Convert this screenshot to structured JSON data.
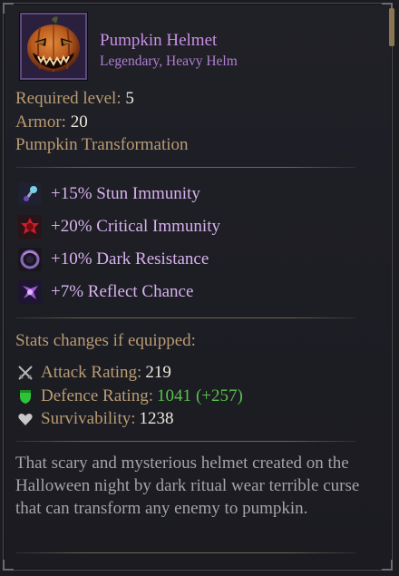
{
  "item": {
    "name": "Pumpkin Helmet",
    "subtitle": "Legendary, Heavy Helm",
    "icon": "pumpkin-helmet-icon"
  },
  "requirements": {
    "level_label": "Required level:",
    "level_value": "5",
    "armor_label": "Armor:",
    "armor_value": "20",
    "special": "Pumpkin Transformation"
  },
  "bonuses": [
    {
      "icon": "stun-immunity-icon",
      "text": "+15% Stun Immunity"
    },
    {
      "icon": "critical-immunity-icon",
      "text": "+20% Critical Immunity"
    },
    {
      "icon": "dark-resistance-icon",
      "text": "+10% Dark Resistance"
    },
    {
      "icon": "reflect-chance-icon",
      "text": "+7% Reflect Chance"
    }
  ],
  "stats": {
    "header": "Stats changes if equipped:",
    "attack_label": "Attack Rating:",
    "attack_value": "219",
    "defence_label": "Defence Rating:",
    "defence_value": "1041",
    "defence_delta": "(+257)",
    "survivability_label": "Survivability:",
    "survivability_value": "1238"
  },
  "description": "That scary and mysterious helmet created on the Halloween night by dark ritual wear terrible curse that can transform any enemy to pumpkin.",
  "colors": {
    "legendary": "#c98fe6",
    "bonus_text": "#d7b2ee",
    "label": "#b99c72",
    "value": "#eee9dc",
    "positive": "#58c24a",
    "description": "#a7a3a6"
  }
}
